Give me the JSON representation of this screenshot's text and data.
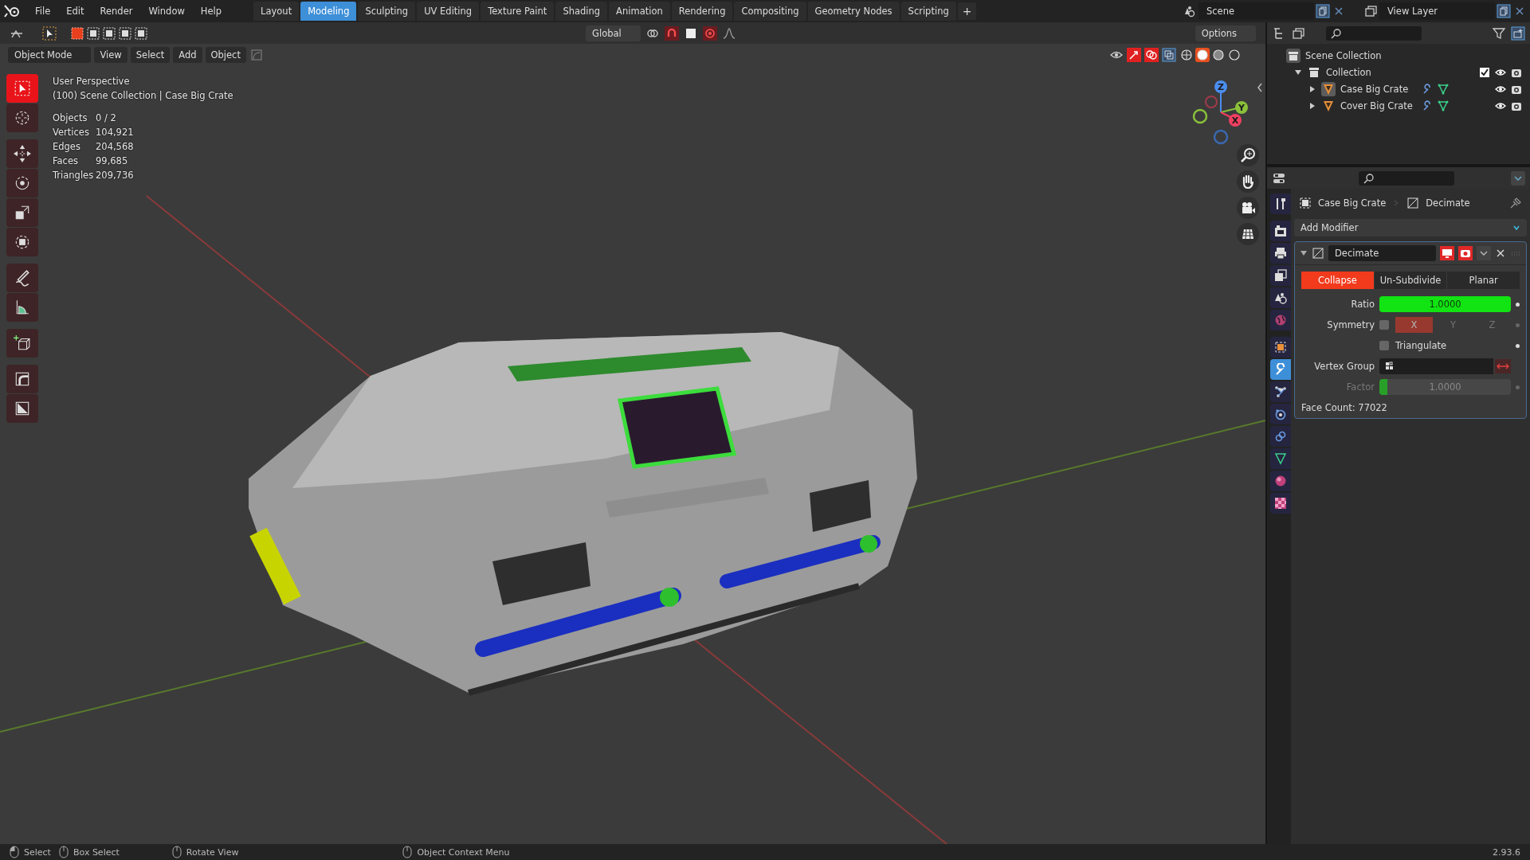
{
  "top_bar": {
    "menu": [
      "File",
      "Edit",
      "Render",
      "Window",
      "Help"
    ],
    "workspaces": [
      {
        "label": "Layout",
        "selected": false
      },
      {
        "label": "Modeling",
        "selected": true
      },
      {
        "label": "Sculpting",
        "selected": false
      },
      {
        "label": "UV Editing",
        "selected": false
      },
      {
        "label": "Texture Paint",
        "selected": false
      },
      {
        "label": "Shading",
        "selected": false
      },
      {
        "label": "Animation",
        "selected": false
      },
      {
        "label": "Rendering",
        "selected": false
      },
      {
        "label": "Compositing",
        "selected": false
      },
      {
        "label": "Geometry Nodes",
        "selected": false
      },
      {
        "label": "Scripting",
        "selected": false
      }
    ],
    "add_workspace": "+",
    "scene": "Scene",
    "view_layer": "View Layer"
  },
  "tool_header": {
    "select_modes": [
      {
        "selected": true
      },
      {
        "selected": false
      },
      {
        "selected": false
      },
      {
        "selected": false
      },
      {
        "selected": false
      }
    ],
    "orientation": "Global",
    "options": "Options"
  },
  "viewport": {
    "mode": "Object Mode",
    "menus": [
      "View",
      "Select",
      "Add",
      "Object"
    ],
    "shading": [
      {
        "selected": false
      },
      {
        "selected": true
      },
      {
        "selected": false
      },
      {
        "selected": false
      }
    ],
    "title": "User Perspective",
    "context": "(100) Scene Collection | Case Big Crate",
    "stats": [
      {
        "label": "Objects",
        "value": "0 / 2"
      },
      {
        "label": "Vertices",
        "value": "104,921"
      },
      {
        "label": "Edges",
        "value": "204,568"
      },
      {
        "label": "Faces",
        "value": "99,685"
      },
      {
        "label": "Triangles",
        "value": "209,736"
      }
    ],
    "tools": [
      {
        "kind": "select",
        "selected": true
      },
      {
        "kind": "cursor",
        "selected": false
      },
      {
        "kind": "move",
        "selected": false
      },
      {
        "kind": "rotate",
        "selected": false
      },
      {
        "kind": "scale",
        "selected": false
      },
      {
        "kind": "transform",
        "selected": false
      },
      {
        "kind": "annotate",
        "selected": false
      },
      {
        "kind": "measure",
        "selected": false
      },
      {
        "kind": "add_cube",
        "selected": false
      },
      {
        "kind": "bend",
        "selected": false
      },
      {
        "kind": "shear",
        "selected": false
      }
    ],
    "gizmo_axes": [
      "Z",
      "Y",
      "X"
    ]
  },
  "outliner": {
    "root": "Scene Collection",
    "collections": [
      {
        "label": "Collection",
        "expanded": true,
        "checked": true,
        "children": [
          {
            "label": "Case Big Crate",
            "expanded": false,
            "active": true
          },
          {
            "label": "Cover Big Crate",
            "expanded": false,
            "active": false
          }
        ]
      }
    ]
  },
  "properties": {
    "tabs": [
      {
        "kind": "tool",
        "selected": false
      },
      {
        "kind": "render",
        "selected": false
      },
      {
        "kind": "output",
        "selected": false
      },
      {
        "kind": "view_layer",
        "selected": false
      },
      {
        "kind": "scene",
        "selected": false
      },
      {
        "kind": "world",
        "selected": false
      },
      {
        "kind": "object",
        "selected": false
      },
      {
        "kind": "modifier",
        "selected": true
      },
      {
        "kind": "particles",
        "selected": false
      },
      {
        "kind": "physics",
        "selected": false
      },
      {
        "kind": "constraints",
        "selected": false
      },
      {
        "kind": "data",
        "selected": false
      },
      {
        "kind": "material",
        "selected": false
      },
      {
        "kind": "texture",
        "selected": false
      }
    ],
    "object": "Case Big Crate",
    "modifier_crumb": "Decimate",
    "add_modifier": "Add Modifier",
    "modifier": {
      "name": "Decimate",
      "expanded": true,
      "show_viewport": true,
      "show_render": true,
      "modes": [
        {
          "label": "Collapse",
          "selected": true
        },
        {
          "label": "Un-Subdivide",
          "selected": false
        },
        {
          "label": "Planar",
          "selected": false
        }
      ],
      "ratio": {
        "label": "Ratio",
        "value": "1.0000",
        "level": 1
      },
      "symmetry": {
        "label": "Symmetry",
        "checked": false,
        "axes": [
          {
            "label": "X",
            "selected": true
          },
          {
            "label": "Y",
            "selected": false
          },
          {
            "label": "Z",
            "selected": false
          }
        ]
      },
      "triangulate": {
        "label": "Triangulate",
        "checked": false
      },
      "vertex_group": {
        "label": "Vertex Group"
      },
      "factor": {
        "label": "Factor",
        "value": "1.0000",
        "level": 0.06,
        "disabled": true
      },
      "face_count": "Face Count: 77022"
    }
  },
  "status_bar": {
    "hints": [
      "Select",
      "Box Select",
      "Rotate View",
      "Object Context Menu"
    ],
    "version": "2.93.6"
  }
}
